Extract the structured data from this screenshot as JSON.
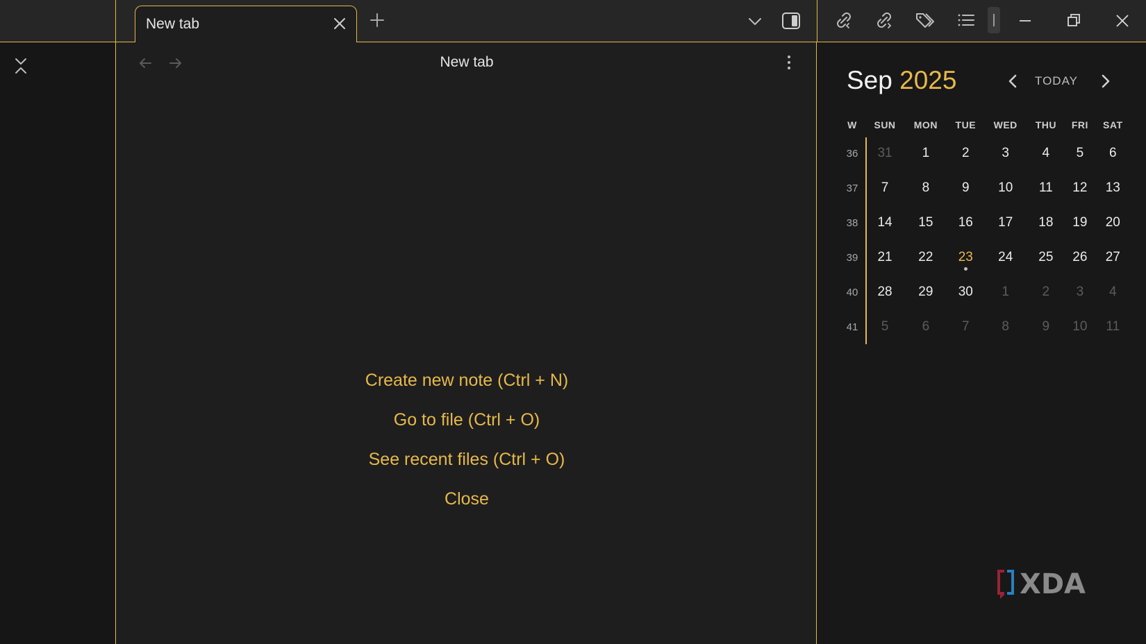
{
  "tab": {
    "title": "New tab"
  },
  "view": {
    "title": "New tab"
  },
  "actions": [
    {
      "label": "Create new note (Ctrl + N)"
    },
    {
      "label": "Go to file (Ctrl + O)"
    },
    {
      "label": "See recent files (Ctrl + O)"
    },
    {
      "label": "Close"
    }
  ],
  "calendar": {
    "month": "Sep",
    "year": "2025",
    "today_label": "TODAY",
    "headers": [
      "W",
      "SUN",
      "MON",
      "TUE",
      "WED",
      "THU",
      "FRI",
      "SAT"
    ],
    "weeks": [
      {
        "num": "36",
        "days": [
          "31",
          "1",
          "2",
          "3",
          "4",
          "5",
          "6"
        ]
      },
      {
        "num": "37",
        "days": [
          "7",
          "8",
          "9",
          "10",
          "11",
          "12",
          "13"
        ]
      },
      {
        "num": "38",
        "days": [
          "14",
          "15",
          "16",
          "17",
          "18",
          "19",
          "20"
        ]
      },
      {
        "num": "39",
        "days": [
          "21",
          "22",
          "23",
          "24",
          "25",
          "26",
          "27"
        ]
      },
      {
        "num": "40",
        "days": [
          "28",
          "29",
          "30",
          "1",
          "2",
          "3",
          "4"
        ]
      },
      {
        "num": "41",
        "days": [
          "5",
          "6",
          "7",
          "8",
          "9",
          "10",
          "11"
        ]
      }
    ]
  },
  "logo": {
    "text": "XDA"
  },
  "colors": {
    "accent": "#e7b94a",
    "background": "#1e1e1e",
    "panel": "#181818",
    "ribbon": "#161616"
  }
}
